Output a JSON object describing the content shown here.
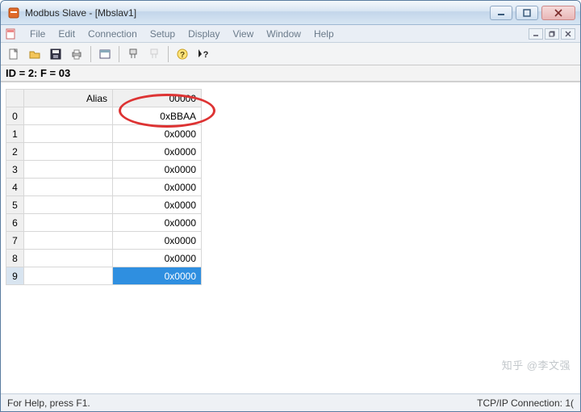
{
  "window": {
    "title": "Modbus Slave - [Mbslav1]"
  },
  "menus": {
    "file": "File",
    "edit": "Edit",
    "connection": "Connection",
    "setup": "Setup",
    "display": "Display",
    "view": "View",
    "window": "Window",
    "help": "Help"
  },
  "idline": "ID = 2: F = 03",
  "grid": {
    "header_alias": "Alias",
    "header_val": "00000",
    "rows": [
      {
        "idx": "0",
        "alias": "",
        "val": "0xBBAA"
      },
      {
        "idx": "1",
        "alias": "",
        "val": "0x0000"
      },
      {
        "idx": "2",
        "alias": "",
        "val": "0x0000"
      },
      {
        "idx": "3",
        "alias": "",
        "val": "0x0000"
      },
      {
        "idx": "4",
        "alias": "",
        "val": "0x0000"
      },
      {
        "idx": "5",
        "alias": "",
        "val": "0x0000"
      },
      {
        "idx": "6",
        "alias": "",
        "val": "0x0000"
      },
      {
        "idx": "7",
        "alias": "",
        "val": "0x0000"
      },
      {
        "idx": "8",
        "alias": "",
        "val": "0x0000"
      },
      {
        "idx": "9",
        "alias": "",
        "val": "0x0000"
      }
    ],
    "selected_index": 9
  },
  "status": {
    "help": "For Help, press F1.",
    "conn": "TCP/IP Connection: 1("
  },
  "watermark": "知乎 @李文强"
}
